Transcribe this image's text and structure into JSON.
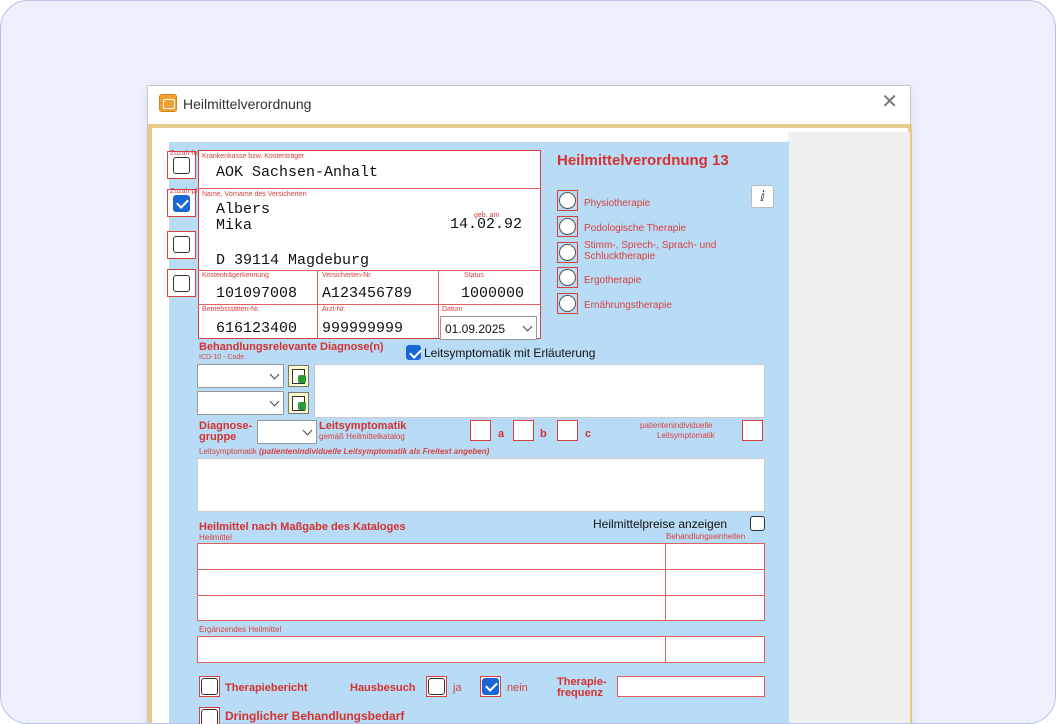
{
  "window": {
    "title": "Heilmittelverordnung"
  },
  "form": {
    "title": "Heilmittelverordnung 13",
    "left_checks": [
      {
        "label": "Zuzah-frei",
        "checked": false
      },
      {
        "label": "Zuzah-pflicht",
        "checked": true
      },
      {
        "label": "Unfall",
        "checked": false
      },
      {
        "label": "BVG",
        "checked": false
      }
    ],
    "insurer": {
      "label": "Krankenkasse bzw. Kostenträger",
      "value": "AOK Sachsen-Anhalt"
    },
    "patient": {
      "label": "Name, Vorname des Versicherten",
      "last_name": "Albers",
      "first_name": "Mika",
      "dob_label": "geb. am",
      "dob": "14.02.92",
      "address": "D 39114 Magdeburg"
    },
    "ids": {
      "kostentraeger_label": "Kostenträgerkennung",
      "kostentraeger": "101097008",
      "versicherten_label": "Versicherten-Nr.",
      "versicherten": "A123456789",
      "status_label": "Status",
      "status": "1000000",
      "betriebsstaetten_label": "Betriebsstätten-Nr.",
      "betriebsstaetten": "616123400",
      "arzt_label": "Arzt-Nr.",
      "arzt": "999999999",
      "datum_label": "Datum",
      "datum": "01.09.2025"
    },
    "therapies": [
      "Physiotherapie",
      "Podologische Therapie",
      "Stimm-, Sprech-, Sprach- und Schlucktherapie",
      "Ergotherapie",
      "Ernährungstherapie"
    ],
    "diagnose": {
      "heading": "Behandlungsrelevante Diagnose(n)",
      "icd_label": "ICD-10 - Code",
      "leitsymptomatik_check_label": "Leitsymptomatik mit Erläuterung",
      "leitsymptomatik_checked": true,
      "gruppe_label_1": "Diagnose-",
      "gruppe_label_2": "gruppe",
      "leit_label": "Leitsymptomatik",
      "leit_sub": "gemäß Heilmittelkatalog",
      "opt_a": "a",
      "opt_b": "b",
      "opt_c": "c",
      "patindiv_1": "patientenindividuelle",
      "patindiv_2": "Leitsymptomatik",
      "freetext_label": "Leitsymptomatik",
      "freetext_hint": "(patientenindividuelle Leitsymptomatik als Freitext angeben)"
    },
    "heilmittel": {
      "heading": "Heilmittel nach Maßgabe des Kataloges",
      "prices_label": "Heilmittelpreise anzeigen",
      "prices_checked": false,
      "col_heilmittel": "Heilmittel",
      "col_einheiten": "Behandlungseinheiten",
      "ergaenzend_label": "Ergänzendes Heilmittel"
    },
    "footer": {
      "therapiebericht": "Therapiebericht",
      "hausbesuch": "Hausbesuch",
      "ja": "ja",
      "nein": "nein",
      "nein_checked": true,
      "frequenz_1": "Therapie-",
      "frequenz_2": "frequenz",
      "dringlich": "Dringlicher Behandlungsbedarf"
    }
  },
  "colors": {
    "form_bg": "#b8dcf5",
    "accent_red": "#d94040",
    "check_blue": "#1a66d6",
    "window_border": "#e8c98c"
  }
}
